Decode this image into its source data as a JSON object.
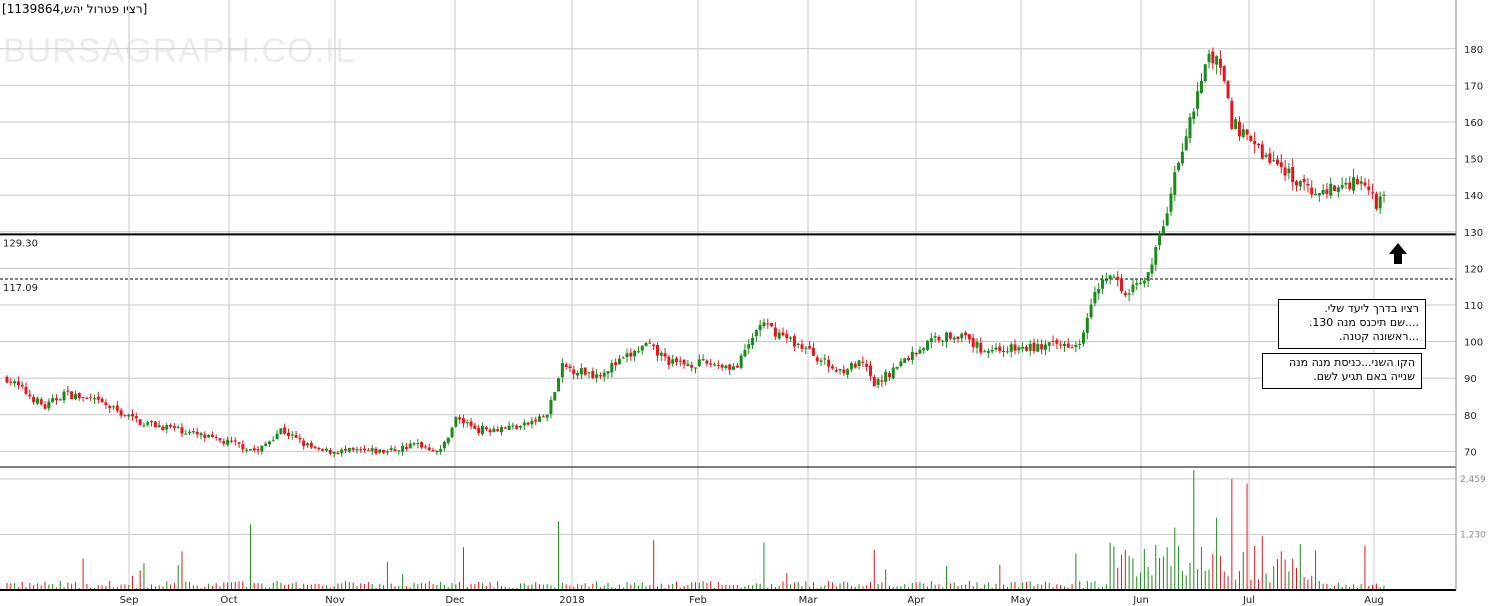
{
  "title": "[רציו פטרול יהש,1139864]",
  "watermark": "BURSAGRAPH.CO.IL",
  "notes": [
    {
      "lines": [
        "רציו בדרך ליעד שלי.",
        "....שם תיכנס מנה  130.",
        "...ראשונה קטנה."
      ]
    },
    {
      "lines": [
        "הקו השני...כניסת מנה מנה",
        "שנייה באם תגיע לשם."
      ]
    }
  ],
  "colors": {
    "up": "#1a8a1a",
    "down": "#e8141c",
    "grid": "#c8c8c8",
    "line": "#000000"
  },
  "icons": {
    "arrow": "up-arrow-icon"
  },
  "chart_data": {
    "type": "candlestick",
    "x_tick_labels": [
      "Sep",
      "Oct",
      "Nov",
      "Dec",
      "2018",
      "Feb",
      "Mar",
      "Apr",
      "May",
      "Jun",
      "Jul",
      "Aug"
    ],
    "y_ticks": [
      70,
      80,
      90,
      100,
      110,
      120,
      130,
      140,
      150,
      160,
      170,
      180
    ],
    "ylim": [
      66,
      190
    ],
    "volume_ticks": [
      {
        "label": "2,459",
        "value": 2459
      },
      {
        "label": "1,230",
        "value": 1230
      }
    ],
    "volume_max": 2700,
    "horizontal_lines": [
      {
        "label": "129.30",
        "value": 129.3,
        "style": "solid"
      },
      {
        "label": "117.09",
        "value": 117.09,
        "style": "dashed"
      }
    ],
    "anchors": [
      [
        0,
        90
      ],
      [
        10,
        82
      ],
      [
        15,
        86
      ],
      [
        25,
        83
      ],
      [
        35,
        78
      ],
      [
        45,
        76
      ],
      [
        55,
        73
      ],
      [
        60,
        72
      ],
      [
        66,
        70
      ],
      [
        72,
        76
      ],
      [
        78,
        72
      ],
      [
        82,
        70
      ],
      [
        90,
        70
      ],
      [
        100,
        70
      ],
      [
        108,
        72
      ],
      [
        114,
        70
      ],
      [
        118,
        79
      ],
      [
        124,
        76
      ],
      [
        136,
        77
      ],
      [
        142,
        80
      ],
      [
        146,
        93
      ],
      [
        155,
        91
      ],
      [
        162,
        95
      ],
      [
        168,
        99
      ],
      [
        175,
        94
      ],
      [
        185,
        94
      ],
      [
        192,
        93
      ],
      [
        198,
        105
      ],
      [
        210,
        98
      ],
      [
        218,
        92
      ],
      [
        225,
        94
      ],
      [
        228,
        88
      ],
      [
        236,
        95
      ],
      [
        244,
        101
      ],
      [
        250,
        102
      ],
      [
        256,
        98
      ],
      [
        266,
        98
      ],
      [
        276,
        99
      ],
      [
        282,
        100
      ],
      [
        286,
        115
      ],
      [
        290,
        118
      ],
      [
        294,
        114
      ],
      [
        300,
        118
      ],
      [
        304,
        131
      ],
      [
        308,
        150
      ],
      [
        312,
        165
      ],
      [
        316,
        178
      ],
      [
        319,
        175
      ],
      [
        322,
        160
      ],
      [
        326,
        155
      ],
      [
        332,
        150
      ],
      [
        337,
        146
      ],
      [
        342,
        141
      ],
      [
        350,
        142
      ],
      [
        356,
        145
      ],
      [
        360,
        138
      ],
      [
        362,
        141
      ]
    ],
    "volume_spikes": [
      [
        64,
        1450
      ],
      [
        145,
        1520
      ],
      [
        170,
        1100
      ],
      [
        199,
        1050
      ],
      [
        290,
        1050
      ],
      [
        307,
        1380
      ],
      [
        312,
        2650
      ],
      [
        318,
        1600
      ],
      [
        322,
        2450
      ],
      [
        326,
        2350
      ],
      [
        330,
        1200
      ]
    ]
  }
}
